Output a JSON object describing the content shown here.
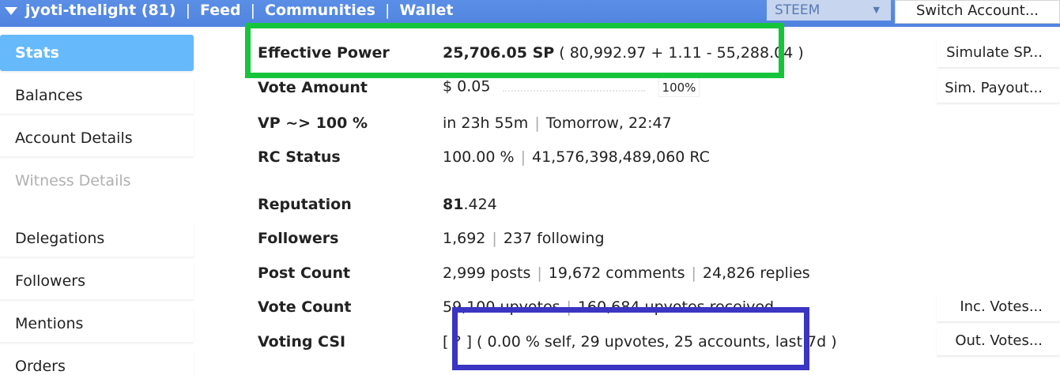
{
  "topbar": {
    "account": "jyoti-thelight (81)",
    "sep": "|",
    "feed": "Feed",
    "communities": "Communities",
    "wallet": "Wallet",
    "chain": "STEEM",
    "switch_account": "Switch Account..."
  },
  "sidebar": {
    "items": [
      {
        "label": "Stats"
      },
      {
        "label": "Balances"
      },
      {
        "label": "Account Details"
      },
      {
        "label": "Witness Details"
      },
      {
        "label": "Delegations"
      },
      {
        "label": "Followers"
      },
      {
        "label": "Mentions"
      },
      {
        "label": "Orders"
      }
    ]
  },
  "stats": {
    "effective_power": {
      "label": "Effective Power",
      "value_bold": "25,706.05 SP",
      "value_detail": " ( 80,992.97 + 1.11 - 55,288.04 )"
    },
    "vote_amount": {
      "label": "Vote Amount",
      "value": "$ 0.05",
      "percent": "100%"
    },
    "vp": {
      "label": "VP ~> 100 %",
      "value": "in 23h 55m",
      "value2": "Tomorrow, 22:47"
    },
    "rc_status": {
      "label": "RC Status",
      "value": "100.00 %",
      "value2": "41,576,398,489,060 RC"
    },
    "reputation": {
      "label": "Reputation",
      "value_bold": "81",
      "value_rest": ".424"
    },
    "followers": {
      "label": "Followers",
      "value": "1,692",
      "value2": "237 following"
    },
    "post_count": {
      "label": "Post Count",
      "value": "2,999 posts",
      "value2": "19,672 comments",
      "value3": "24,826 replies"
    },
    "vote_count": {
      "label": "Vote Count",
      "value": "59,100 upvotes",
      "value2": "160,684 upvotes received"
    },
    "voting_csi": {
      "label": "Voting CSI",
      "value": "[ ? ] ( 0.00 % self, 29 upvotes, 25 accounts, last 7d )"
    }
  },
  "buttons": {
    "simulate_sp": "Simulate SP...",
    "sim_payout": "Sim. Payout...",
    "inc_votes": "Inc. Votes...",
    "out_votes": "Out. Votes..."
  },
  "highlight_colors": {
    "green": "#16c43c",
    "blue": "#3a35c2"
  }
}
